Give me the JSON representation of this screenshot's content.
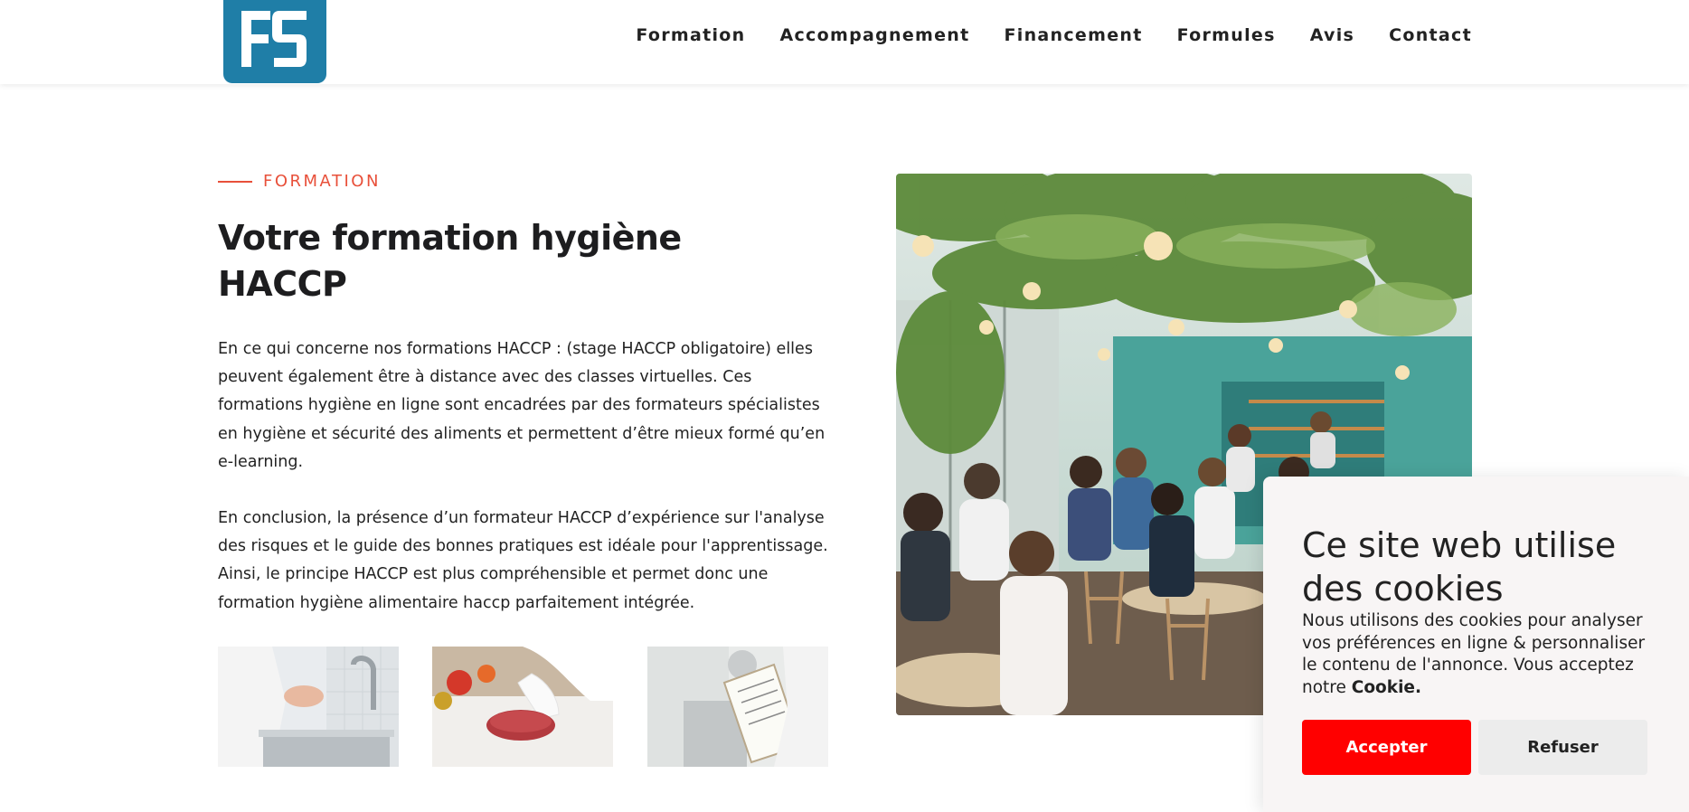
{
  "brand": {
    "logo_text": "FS",
    "logo_color": "#1f7ea7"
  },
  "nav": {
    "items": [
      {
        "label": "Formation"
      },
      {
        "label": "Accompagnement"
      },
      {
        "label": "Financement"
      },
      {
        "label": "Formules"
      },
      {
        "label": "Avis"
      },
      {
        "label": "Contact"
      }
    ]
  },
  "section": {
    "eyebrow": "FORMATION",
    "title": "Votre formation hygiène HACCP",
    "paragraph1": "En ce qui concerne nos formations HACCP : (stage HACCP obligatoire) elles peuvent également être à distance avec des classes virtuelles. Ces formations hygiène en ligne sont encadrées par des formateurs spécialistes en hygiène et sécurité des aliments et permettent d’être mieux formé qu’en e-learning.",
    "paragraph2": "En conclusion, la présence d’un formateur HACCP d’expérience sur l'analyse des risques et le guide des bonnes pratiques est idéale pour l'apprentissage. Ainsi, le principe HACCP est plus compréhensible et permet donc une formation hygiène alimentaire haccp parfaitement intégrée."
  },
  "cookie": {
    "title": "Ce site web utilise des cookies",
    "text": "Nous utilisons des cookies pour analyser vos préférences en ligne & personnaliser le contenu de l'annonce. Vous acceptez notre ",
    "text_bold": "Cookie.",
    "accept_label": "Accepter",
    "refuse_label": "Refuser"
  },
  "colors": {
    "accent": "#e8503a",
    "accept": "#ff0000",
    "brand": "#1f7ea7"
  }
}
